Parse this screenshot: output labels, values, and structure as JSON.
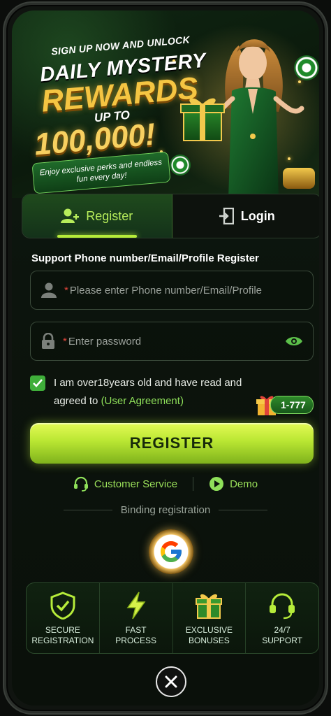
{
  "banner": {
    "promo_top": "SIGN UP NOW AND UNLOCK",
    "promo_title": "DAILY MYSTERY",
    "promo_rewards": "REWARDS",
    "promo_upto": "UP TO",
    "promo_amount": "100,000!",
    "promo_ribbon": "Enjoy exclusive perks and endless fun every day!"
  },
  "tabs": [
    {
      "label": "Register",
      "icon": "add-user-icon",
      "active": true
    },
    {
      "label": "Login",
      "icon": "login-door-icon",
      "active": false
    }
  ],
  "form": {
    "label": "Support Phone number/Email/Profile Register",
    "account_placeholder": "Please enter Phone number/Email/Profile",
    "password_placeholder": "Enter password",
    "required_mark": "*",
    "agree_text": "I am over18years old and have read and agreed to",
    "agree_link": "(User Agreement)",
    "agree_checked": true,
    "bonus_badge": "1-777",
    "register_button": "REGISTER"
  },
  "links": {
    "customer_service": "Customer Service",
    "demo": "Demo"
  },
  "binding": {
    "label": "Binding registration",
    "google_icon": "google-icon"
  },
  "features": [
    {
      "label_line1": "SECURE",
      "label_line2": "REGISTRATION",
      "icon": "shield-check-icon"
    },
    {
      "label_line1": "FAST",
      "label_line2": "PROCESS",
      "icon": "lightning-icon"
    },
    {
      "label_line1": "EXCLUSIVE",
      "label_line2": "BONUSES",
      "icon": "gift-icon"
    },
    {
      "label_line1": "24/7",
      "label_line2": "SUPPORT",
      "icon": "headset-icon"
    }
  ],
  "colors": {
    "accent": "#b6ec3a",
    "link": "#8fe05a",
    "required": "#e0443a",
    "checkbox": "#3fae3a"
  }
}
